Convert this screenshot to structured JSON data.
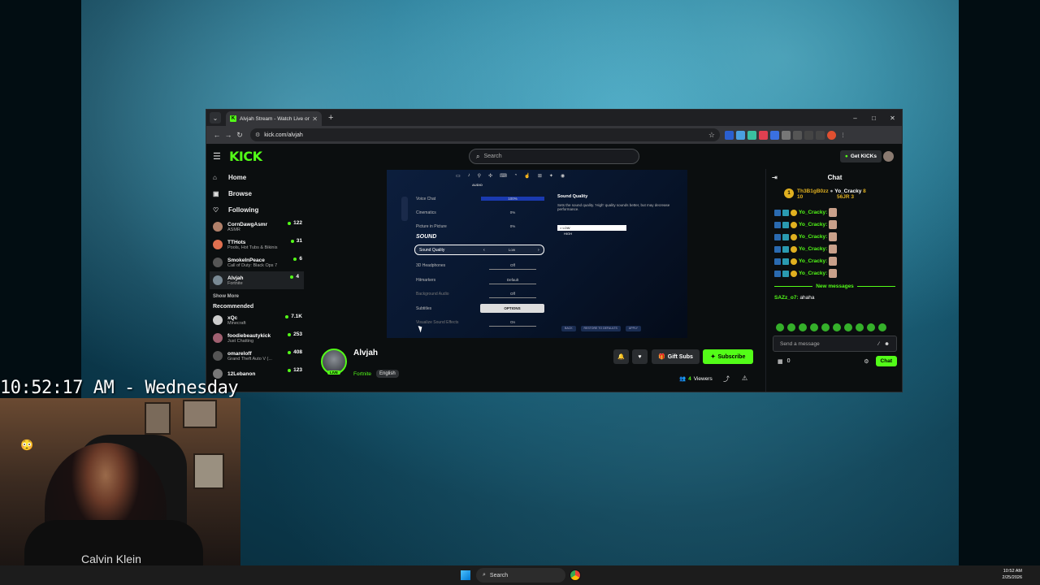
{
  "browser": {
    "tab_title": "Alvjah Stream - Watch Live on K",
    "tab_favicon": "K",
    "url": "kick.com/alvjah",
    "window_controls": [
      "–",
      "□",
      "✕"
    ]
  },
  "kick": {
    "logo": "KICK",
    "search_placeholder": "Search",
    "get_kicks": "Get KICKs",
    "nav": [
      {
        "label": "Home",
        "icon": "home-icon"
      },
      {
        "label": "Browse",
        "icon": "browse-icon"
      },
      {
        "label": "Following",
        "icon": "heart-icon"
      }
    ],
    "following": [
      {
        "name": "CornDawgAsmr",
        "game": "ASMR",
        "viewers": "122",
        "color": "#b0806a"
      },
      {
        "name": "TTHots",
        "game": "Pools, Hot Tubs & Bikinis",
        "viewers": "31",
        "color": "#e07050"
      },
      {
        "name": "SmokeInPeace",
        "game": "Call of Duty: Black Ops 7",
        "viewers": "6",
        "color": "#555"
      },
      {
        "name": "Alvjah",
        "game": "Fortnite",
        "viewers": "4",
        "color": "#7a8a95"
      }
    ],
    "show_more": "Show More",
    "recommended_heading": "Recommended",
    "recommended": [
      {
        "name": "xQc",
        "game": "Minecraft",
        "viewers": "7.1K",
        "color": "#ccc"
      },
      {
        "name": "foodiebeautykick",
        "game": "Just Chatting",
        "viewers": "253",
        "color": "#a06070"
      },
      {
        "name": "omareloff",
        "game": "Grand Theft Auto V (...",
        "viewers": "408",
        "color": "#555"
      },
      {
        "name": "12Lebanon",
        "game": "",
        "viewers": "123",
        "color": "#777"
      }
    ]
  },
  "player": {
    "tab_audio": "AUDIO",
    "settings": [
      {
        "label": "Voice Chat",
        "value": "100%"
      },
      {
        "label": "Cinematics",
        "value": "0%"
      },
      {
        "label": "Picture in Picture",
        "value": "0%"
      }
    ],
    "sound_heading": "SOUND",
    "sound_rows": [
      {
        "label": "Sound Quality",
        "value": "Low"
      },
      {
        "label": "3D Headphones",
        "value": "Off"
      },
      {
        "label": "Hitmarkers",
        "value": "Default"
      },
      {
        "label": "Background Audio",
        "value": "Off"
      },
      {
        "label": "Subtitles",
        "value": ""
      },
      {
        "label": "Visualize Sound Effects",
        "value": "On"
      }
    ],
    "options_button": "OPTIONS",
    "panel_title": "Sound Quality",
    "panel_desc": "Sets the sound quality. 'High' quality sounds better, but may decrease performance.",
    "panel_low": "> LOW",
    "panel_high": "HIGH",
    "footer_buttons": [
      "BACK",
      "RESTORE TO DEFAULTS",
      "APPLY"
    ]
  },
  "stream": {
    "name": "Alvjah",
    "live_badge": "LIVE",
    "category": "Fortnite",
    "language": "English",
    "gift_subs": "Gift Subs",
    "subscribe": "Subscribe",
    "viewers_count": "4",
    "viewers_label": "Viewers"
  },
  "chat": {
    "title": "Chat",
    "pinned_user1": "Th3B1gB0zz",
    "pinned_amount1": "10",
    "pinned_user2": "Yo_Cracky",
    "pinned_amount2": "8",
    "pinned_amount3": "56JR",
    "pinned_amount4": "3",
    "messages": [
      "Yo_Cracky:",
      "Yo_Cracky:",
      "Yo_Cracky:",
      "Yo_Cracky:",
      "Yo_Cracky:",
      "Yo_Cracky:"
    ],
    "new_messages": "New messages",
    "last_user": "SAZz_o7:",
    "last_text": "ahaha",
    "input_placeholder": "Send a message",
    "points": "0",
    "send_button": "Chat"
  },
  "overlay": {
    "clock": "10:52:17 AM - Wednesday"
  },
  "webcam": {
    "shirt_brand": "Calvin Klein"
  },
  "taskbar": {
    "search": "Search",
    "time": "10:52 AM",
    "date": "2/25/2026"
  }
}
